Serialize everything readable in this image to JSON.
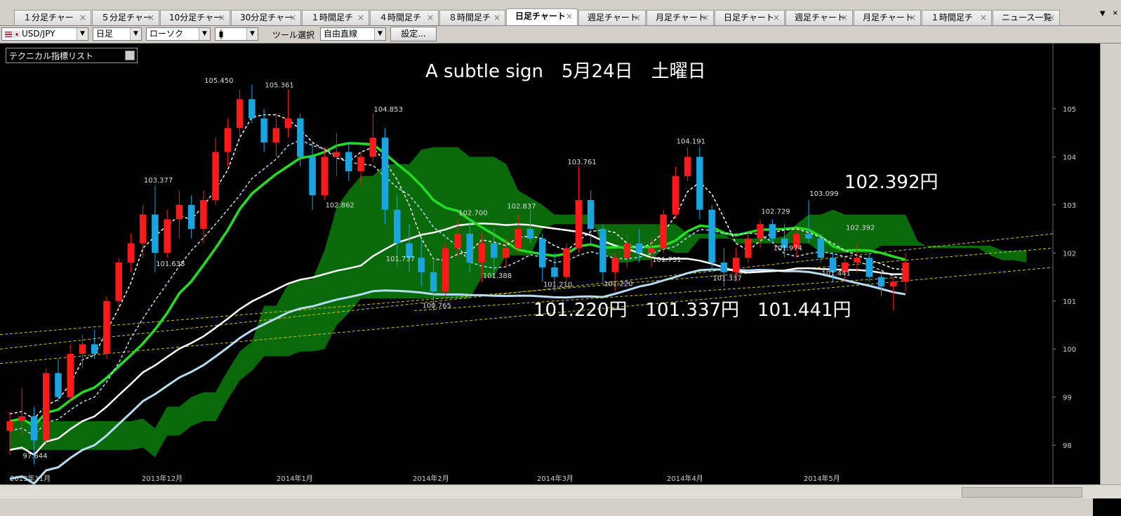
{
  "tabs": [
    {
      "label": "１分足チャー",
      "active": false
    },
    {
      "label": "５分足チャー",
      "active": false
    },
    {
      "label": "10分足チャー",
      "active": false
    },
    {
      "label": "30分足チャー",
      "active": false
    },
    {
      "label": "１時間足チ",
      "active": false
    },
    {
      "label": "４時間足チ",
      "active": false
    },
    {
      "label": "８時間足チ",
      "active": false
    },
    {
      "label": "日足チャート",
      "active": true
    },
    {
      "label": "週足チャート",
      "active": false
    },
    {
      "label": "月足チャート",
      "active": false
    },
    {
      "label": "日足チャート",
      "active": false
    },
    {
      "label": "週足チャート",
      "active": false
    },
    {
      "label": "月足チャート",
      "active": false
    },
    {
      "label": "１時間足チ",
      "active": false
    },
    {
      "label": "ニュース一覧",
      "active": false
    }
  ],
  "tab_close_glyph": "×",
  "toolbar": {
    "pair": "USD/JPY",
    "period": "日足",
    "chart_type": "ローソク",
    "tool_label": "ツール選択",
    "tool_value": "自由直線",
    "settings": "設定..."
  },
  "indicator_list": "テクニカル指標リスト",
  "chart_data": {
    "type": "candlestick",
    "title": "A subtle sign　5月24日　土曜日",
    "annotations": {
      "top_right": "102.392円",
      "bottom": "101.220円　101.337円　101.441円"
    },
    "ylim": [
      97.3,
      106.2
    ],
    "y_ticks": [
      98,
      99,
      100,
      101,
      102,
      103,
      104,
      105
    ],
    "x_ticks": [
      "2013年11月",
      "2013年12月",
      "2014年1月",
      "2014年2月",
      "2014年3月",
      "2014年4月",
      "2014年5月"
    ],
    "price_labels": [
      {
        "t": "105.450",
        "x": 17,
        "v": 105.45
      },
      {
        "t": "105.361",
        "x": 22,
        "v": 105.36
      },
      {
        "t": "104.853",
        "x": 31,
        "v": 104.85
      },
      {
        "t": "103.377",
        "x": 12,
        "v": 103.38
      },
      {
        "t": "102.862",
        "x": 27,
        "v": 102.86
      },
      {
        "t": "101.638",
        "x": 13,
        "v": 101.64
      },
      {
        "t": "101.737",
        "x": 32,
        "v": 101.74
      },
      {
        "t": "100.765",
        "x": 35,
        "v": 100.77
      },
      {
        "t": "102.700",
        "x": 38,
        "v": 102.7
      },
      {
        "t": "102.837",
        "x": 42,
        "v": 102.84
      },
      {
        "t": "101.388",
        "x": 40,
        "v": 101.39
      },
      {
        "t": "103.761",
        "x": 47,
        "v": 103.76
      },
      {
        "t": "101.210",
        "x": 45,
        "v": 101.21
      },
      {
        "t": "101.220",
        "x": 50,
        "v": 101.22
      },
      {
        "t": "104.191",
        "x": 56,
        "v": 104.19
      },
      {
        "t": "101.731",
        "x": 54,
        "v": 101.73
      },
      {
        "t": "101.337",
        "x": 59,
        "v": 101.34
      },
      {
        "t": "102.729",
        "x": 63,
        "v": 102.73
      },
      {
        "t": "101.974",
        "x": 64,
        "v": 101.97
      },
      {
        "t": "103.099",
        "x": 67,
        "v": 103.1
      },
      {
        "t": "102.392",
        "x": 70,
        "v": 102.39
      },
      {
        "t": "101.441",
        "x": 68,
        "v": 101.44
      },
      {
        "t": "97.644",
        "x": 2,
        "v": 97.64
      }
    ],
    "candles": [
      [
        98.3,
        98.7,
        97.8,
        98.5
      ],
      [
        98.5,
        99.2,
        98.2,
        98.6
      ],
      [
        98.6,
        98.8,
        97.6,
        98.1
      ],
      [
        98.1,
        99.6,
        98.0,
        99.5
      ],
      [
        99.5,
        99.8,
        98.9,
        99.0
      ],
      [
        99.0,
        100.1,
        98.9,
        99.9
      ],
      [
        99.9,
        100.3,
        99.6,
        100.1
      ],
      [
        100.1,
        100.4,
        99.8,
        99.9
      ],
      [
        99.9,
        101.1,
        99.8,
        101.0
      ],
      [
        101.0,
        101.9,
        100.8,
        101.8
      ],
      [
        101.8,
        102.4,
        101.6,
        102.2
      ],
      [
        102.2,
        103.0,
        101.9,
        102.8
      ],
      [
        102.8,
        103.4,
        101.6,
        102.0
      ],
      [
        102.0,
        102.9,
        101.9,
        102.7
      ],
      [
        102.7,
        103.3,
        102.3,
        103.0
      ],
      [
        103.0,
        103.2,
        102.3,
        102.5
      ],
      [
        102.5,
        103.3,
        102.2,
        103.1
      ],
      [
        103.1,
        104.4,
        103.0,
        104.1
      ],
      [
        104.1,
        104.8,
        103.8,
        104.6
      ],
      [
        104.6,
        105.4,
        104.4,
        105.2
      ],
      [
        105.2,
        105.5,
        104.7,
        104.8
      ],
      [
        104.8,
        105.0,
        104.1,
        104.3
      ],
      [
        104.3,
        104.9,
        104.0,
        104.6
      ],
      [
        104.6,
        105.4,
        104.4,
        104.8
      ],
      [
        104.8,
        104.9,
        103.8,
        104.0
      ],
      [
        104.0,
        104.3,
        102.9,
        103.2
      ],
      [
        103.2,
        104.2,
        103.1,
        104.0
      ],
      [
        104.0,
        104.5,
        103.6,
        104.1
      ],
      [
        104.1,
        104.3,
        103.5,
        103.7
      ],
      [
        103.7,
        104.1,
        103.4,
        104.0
      ],
      [
        104.0,
        104.9,
        103.9,
        104.4
      ],
      [
        104.4,
        104.6,
        102.6,
        102.9
      ],
      [
        102.9,
        103.2,
        101.7,
        102.2
      ],
      [
        102.2,
        102.6,
        101.6,
        101.9
      ],
      [
        101.9,
        102.3,
        101.3,
        101.6
      ],
      [
        101.6,
        101.9,
        100.8,
        101.2
      ],
      [
        101.2,
        102.2,
        101.1,
        102.1
      ],
      [
        102.1,
        102.7,
        101.9,
        102.4
      ],
      [
        102.4,
        102.7,
        101.6,
        101.8
      ],
      [
        101.8,
        102.4,
        101.4,
        102.2
      ],
      [
        102.2,
        102.5,
        101.6,
        101.9
      ],
      [
        101.9,
        102.3,
        101.7,
        102.1
      ],
      [
        102.1,
        102.8,
        102.0,
        102.5
      ],
      [
        102.5,
        102.9,
        102.2,
        102.3
      ],
      [
        102.3,
        102.4,
        101.4,
        101.7
      ],
      [
        101.7,
        102.0,
        101.2,
        101.5
      ],
      [
        101.5,
        102.2,
        101.4,
        102.1
      ],
      [
        102.1,
        103.8,
        102.0,
        103.1
      ],
      [
        103.1,
        103.3,
        102.2,
        102.5
      ],
      [
        102.5,
        102.6,
        101.4,
        101.6
      ],
      [
        101.6,
        102.0,
        101.2,
        101.9
      ],
      [
        101.9,
        102.4,
        101.7,
        102.2
      ],
      [
        102.2,
        102.5,
        101.8,
        102.0
      ],
      [
        102.0,
        102.3,
        101.7,
        102.1
      ],
      [
        102.1,
        102.9,
        102.0,
        102.8
      ],
      [
        102.8,
        103.8,
        102.7,
        103.6
      ],
      [
        103.6,
        104.2,
        103.5,
        104.0
      ],
      [
        104.0,
        104.2,
        102.7,
        102.9
      ],
      [
        102.9,
        103.0,
        101.6,
        101.8
      ],
      [
        101.8,
        102.1,
        101.3,
        101.6
      ],
      [
        101.6,
        102.1,
        101.4,
        101.9
      ],
      [
        101.9,
        102.4,
        101.8,
        102.3
      ],
      [
        102.3,
        102.7,
        102.1,
        102.6
      ],
      [
        102.6,
        102.7,
        102.2,
        102.3
      ],
      [
        102.3,
        102.6,
        101.9,
        102.1
      ],
      [
        102.1,
        102.5,
        101.9,
        102.4
      ],
      [
        102.4,
        103.1,
        102.2,
        102.3
      ],
      [
        102.3,
        102.4,
        101.8,
        101.9
      ],
      [
        101.9,
        102.0,
        101.4,
        101.6
      ],
      [
        101.6,
        101.9,
        101.4,
        101.8
      ],
      [
        101.8,
        102.2,
        101.6,
        101.9
      ],
      [
        101.9,
        102.0,
        101.4,
        101.5
      ],
      [
        101.5,
        101.6,
        101.1,
        101.3
      ],
      [
        101.3,
        101.5,
        100.8,
        101.4
      ],
      [
        101.4,
        102.0,
        101.2,
        101.8
      ]
    ],
    "colors": {
      "bull": "#ff1a1a",
      "bear": "#1aa5e0",
      "ma_green": "#22dd22",
      "ma_white": "#ffffff",
      "ma_lightblue": "#b7dcf0",
      "kumo_green": "#0a7d0a",
      "kumo_blue": "#2a7f9e",
      "trend": "#d4c800",
      "bg": "#000000"
    }
  }
}
